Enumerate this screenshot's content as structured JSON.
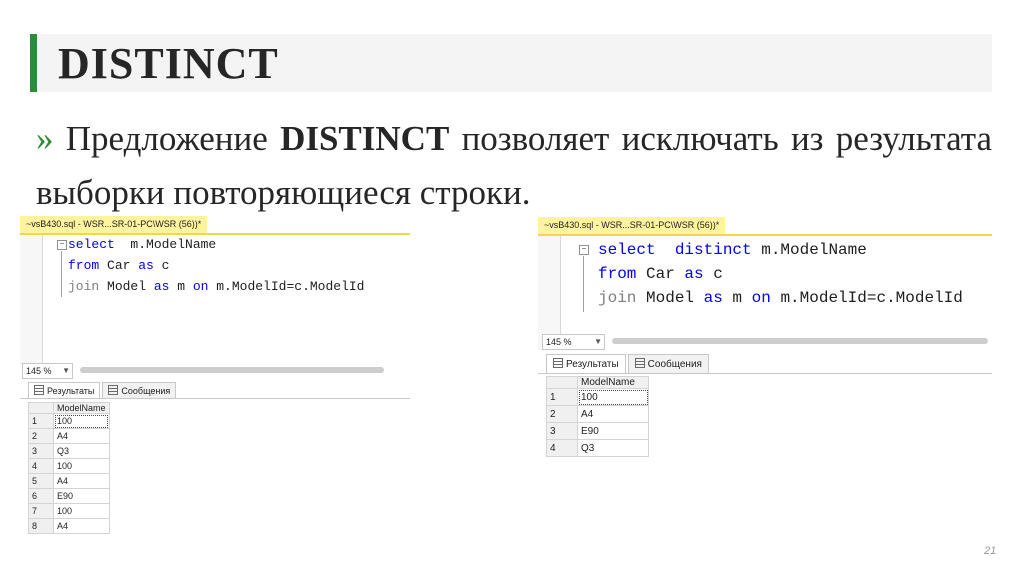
{
  "slide": {
    "title": "DISTINCT",
    "bullet": "»",
    "para_pre": " Предложение ",
    "para_bold": "DISTINCT",
    "para_post": " позволяет исключать из результата выборки повторяющиеся строки.",
    "page_number": "21",
    "accent_color": "#2e8b3a"
  },
  "left_window": {
    "tab_title": "~vsB430.sql - WSR...SR-01-PC\\WSR (56))*",
    "line1": {
      "kw": "select",
      "rest": "  m.ModelName"
    },
    "line2": {
      "kw1": "from",
      "mid": " Car ",
      "kw2": "as",
      "end": " c"
    },
    "line3": {
      "join": "join",
      "mid": " Model ",
      "kw": "as",
      "mid2": " m ",
      "kw2": "on",
      "end": " m.ModelId=c.ModelId"
    },
    "zoom": "145 %",
    "tab_results": "Результаты",
    "tab_messages": "Сообщения",
    "column_header": "ModelName",
    "rows": [
      {
        "n": "1",
        "v": "100"
      },
      {
        "n": "2",
        "v": "A4"
      },
      {
        "n": "3",
        "v": "Q3"
      },
      {
        "n": "4",
        "v": "100"
      },
      {
        "n": "5",
        "v": "A4"
      },
      {
        "n": "6",
        "v": "E90"
      },
      {
        "n": "7",
        "v": "100"
      },
      {
        "n": "8",
        "v": "A4"
      }
    ]
  },
  "right_window": {
    "tab_title": "~vsB430.sql - WSR...SR-01-PC\\WSR (56))*",
    "line1": {
      "kw": "select",
      "kw2": "distinct",
      "rest": " m.ModelName"
    },
    "line2": {
      "kw1": "from",
      "mid": " Car ",
      "kw2": "as",
      "end": " c"
    },
    "line3": {
      "join": "join",
      "mid": " Model ",
      "kw": "as",
      "mid2": " m ",
      "kw2": "on",
      "end": " m.ModelId=c.ModelId"
    },
    "zoom": "145 %",
    "tab_results": "Результаты",
    "tab_messages": "Сообщения",
    "column_header": "ModelName",
    "rows": [
      {
        "n": "1",
        "v": "100"
      },
      {
        "n": "2",
        "v": "A4"
      },
      {
        "n": "3",
        "v": "E90"
      },
      {
        "n": "4",
        "v": "Q3"
      }
    ]
  }
}
